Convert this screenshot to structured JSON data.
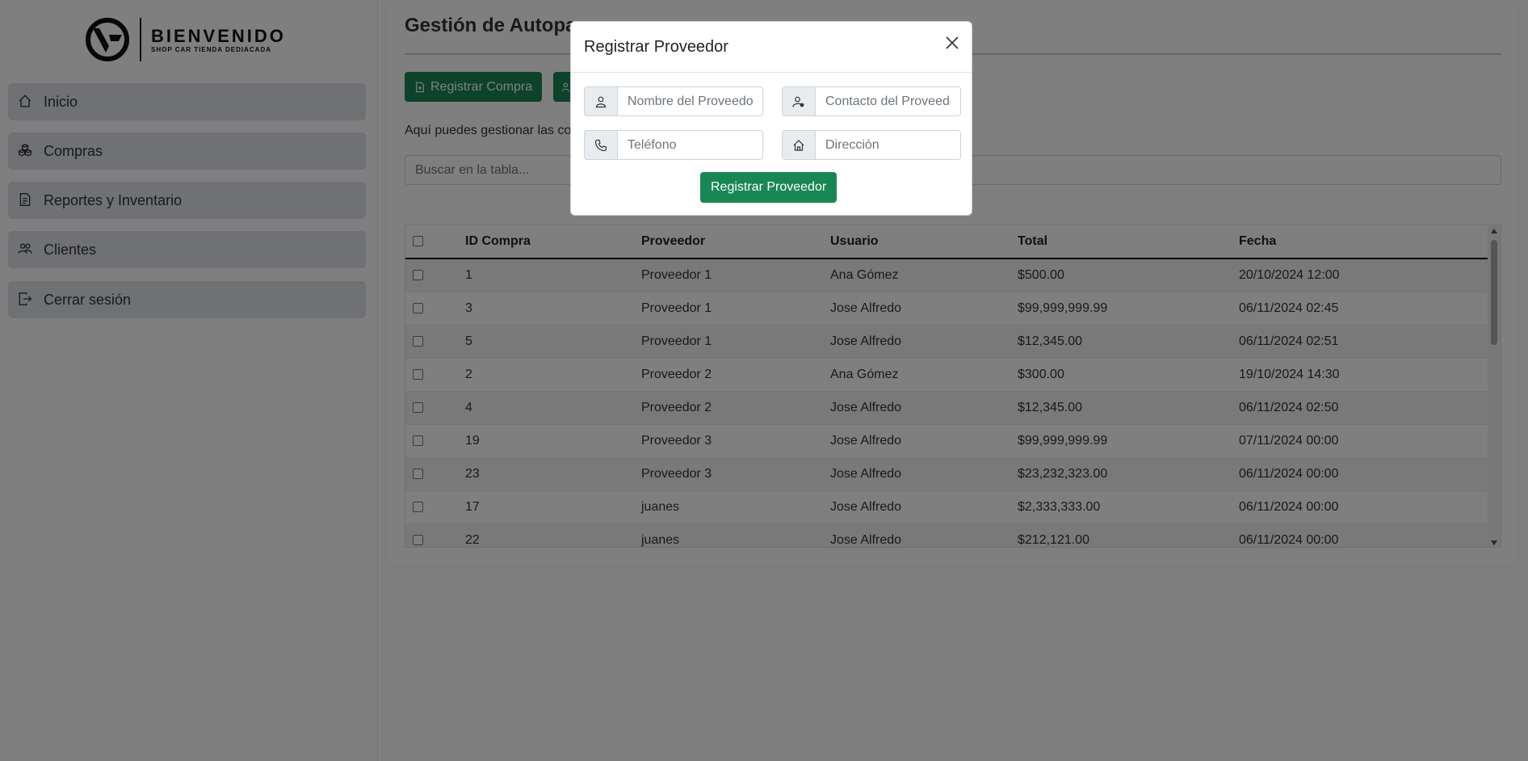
{
  "logo": {
    "title": "BIENVENIDO",
    "subtitle": "SHOP CAR TIENDA DEDIACADA"
  },
  "sidebar": {
    "items": [
      {
        "label": "Inicio",
        "icon": "home-icon"
      },
      {
        "label": "Compras",
        "icon": "boxes-icon"
      },
      {
        "label": "Reportes y Inventario",
        "icon": "file-text-icon"
      },
      {
        "label": "Clientes",
        "icon": "people-icon"
      },
      {
        "label": "Cerrar sesión",
        "icon": "logout-icon"
      }
    ]
  },
  "main": {
    "title": "Gestión de Autopa",
    "buttons": {
      "register_purchase": "Registrar Compra"
    },
    "description": "Aquí puedes gestionar las co",
    "search_placeholder": "Buscar en la tabla..."
  },
  "table": {
    "headers": [
      "ID Compra",
      "Proveedor",
      "Usuario",
      "Total",
      "Fecha"
    ],
    "rows": [
      [
        "1",
        "Proveedor 1",
        "Ana Gómez",
        "$500.00",
        "20/10/2024 12:00"
      ],
      [
        "3",
        "Proveedor 1",
        "Jose Alfredo",
        "$99,999,999.99",
        "06/11/2024 02:45"
      ],
      [
        "5",
        "Proveedor 1",
        "Jose Alfredo",
        "$12,345.00",
        "06/11/2024 02:51"
      ],
      [
        "2",
        "Proveedor 2",
        "Ana Gómez",
        "$300.00",
        "19/10/2024 14:30"
      ],
      [
        "4",
        "Proveedor 2",
        "Jose Alfredo",
        "$12,345.00",
        "06/11/2024 02:50"
      ],
      [
        "19",
        "Proveedor 3",
        "Jose Alfredo",
        "$99,999,999.99",
        "07/11/2024 00:00"
      ],
      [
        "23",
        "Proveedor 3",
        "Jose Alfredo",
        "$23,232,323.00",
        "06/11/2024 00:00"
      ],
      [
        "17",
        "juanes",
        "Jose Alfredo",
        "$2,333,333.00",
        "06/11/2024 00:00"
      ],
      [
        "22",
        "juanes",
        "Jose Alfredo",
        "$212,121.00",
        "06/11/2024 00:00"
      ]
    ]
  },
  "modal": {
    "title": "Registrar Proveedor",
    "fields": {
      "name_placeholder": "Nombre del Proveedor",
      "contact_placeholder": "Contacto del Proveedor",
      "phone_placeholder": "Teléfono",
      "address_placeholder": "Dirección"
    },
    "submit_label": "Registrar Proveedor"
  },
  "colors": {
    "primary_green": "#198754",
    "overlay": "rgba(0,0,0,0.5)"
  }
}
